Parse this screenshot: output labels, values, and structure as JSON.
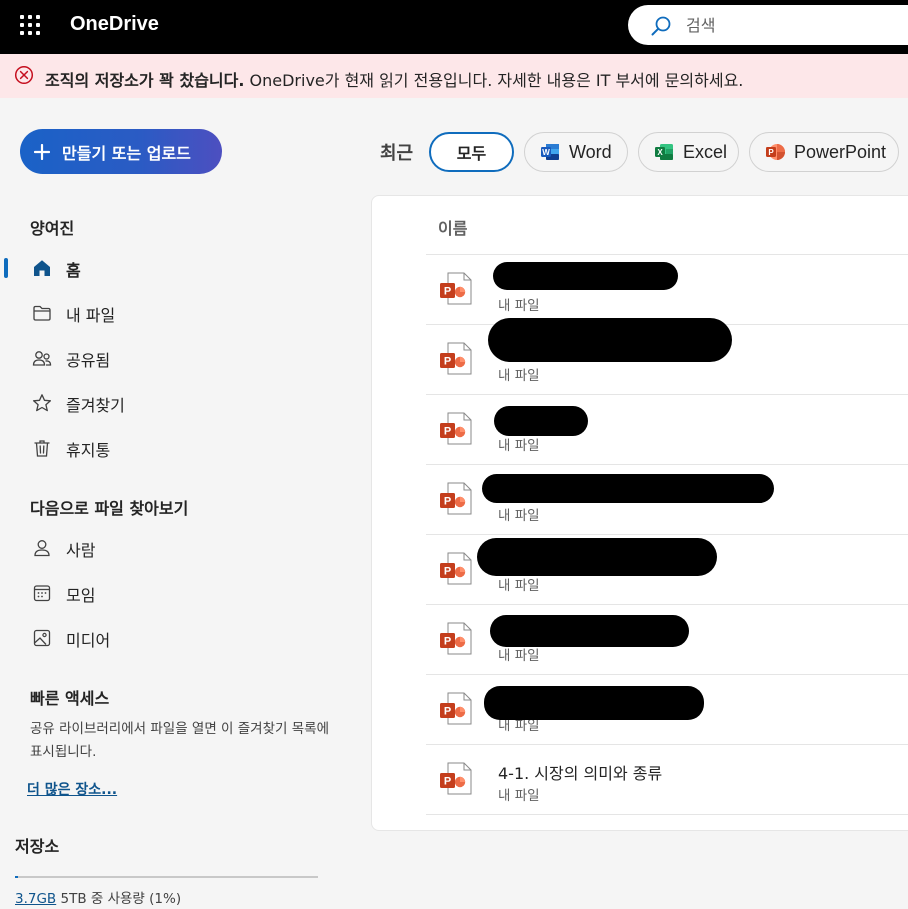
{
  "header": {
    "app_name": "OneDrive",
    "search_placeholder": "검색"
  },
  "banner": {
    "bold_text": "조직의 저장소가 꽉 찼습니다.",
    "text": " OneDrive가 현재 읽기 전용입니다. 자세한 내용은 IT 부서에 문의하세요.",
    "color": "#fde7e9",
    "icon": "error-circle-icon"
  },
  "create_button": {
    "label": "만들기 또는 업로드",
    "icon": "plus-icon"
  },
  "sidebar": {
    "section_user": "양여진",
    "nav": [
      {
        "label": "홈",
        "icon": "home-icon",
        "active": true
      },
      {
        "label": "내 파일",
        "icon": "folder-icon"
      },
      {
        "label": "공유됨",
        "icon": "people-icon"
      },
      {
        "label": "즐겨찾기",
        "icon": "star-icon"
      },
      {
        "label": "휴지통",
        "icon": "trash-icon"
      }
    ],
    "browse_heading": "다음으로 파일 찾아보기",
    "browse": [
      {
        "label": "사람",
        "icon": "person-icon"
      },
      {
        "label": "모임",
        "icon": "calendar-icon"
      },
      {
        "label": "미디어",
        "icon": "image-icon"
      }
    ],
    "quick_access_heading": "빠른 액세스",
    "quick_access_desc": "공유 라이브러리에서 파일을 열면 이 즐겨찾기 목록에 표시됩니다.",
    "more_places": "더 많은 장소..."
  },
  "storage": {
    "title": "저장소",
    "used": "3.7GB",
    "rest": " 5TB 중 사용량 (1%)",
    "percent": 1
  },
  "filters": {
    "recent_label": "최근",
    "chips": [
      {
        "label": "모두",
        "selected": true
      },
      {
        "label": "Word",
        "icon": "word-icon"
      },
      {
        "label": "Excel",
        "icon": "excel-icon"
      },
      {
        "label": "PowerPoint",
        "icon": "powerpoint-icon"
      }
    ]
  },
  "files": {
    "column_name": "이름",
    "rows": [
      {
        "name": "",
        "location": "내 파일"
      },
      {
        "name": "",
        "location": "내 파일"
      },
      {
        "name": "",
        "location": "내 파일"
      },
      {
        "name": "",
        "location": "내 파일"
      },
      {
        "name": "",
        "location": "내 파일"
      },
      {
        "name": "",
        "location": "내 파일"
      },
      {
        "name": "",
        "location": "내 파일"
      },
      {
        "name": "4-1. 시장의 의미와 종류",
        "location": "내 파일"
      }
    ]
  },
  "colors": {
    "accent": "#0f6cbd",
    "powerpoint": "#c43e1c",
    "word": "#185abd",
    "excel": "#107c41"
  }
}
